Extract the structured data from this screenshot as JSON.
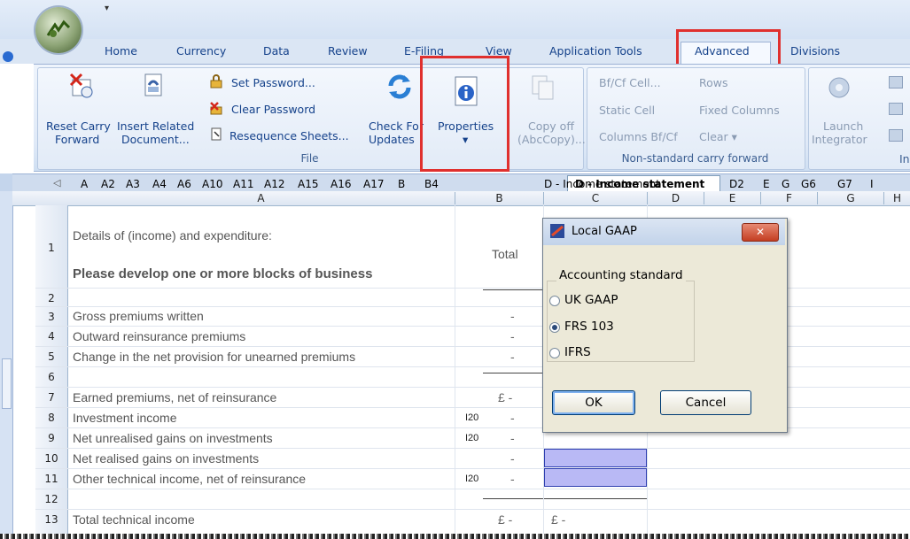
{
  "ribbon_tabs": {
    "home": "Home",
    "currency": "Currency",
    "data": "Data",
    "review": "Review",
    "efiling": "E-Filing",
    "view": "View",
    "application_tools": "Application Tools",
    "advanced": "Advanced",
    "divisions": "Divisions"
  },
  "file_group": {
    "reset_carry_1": "Reset Carry",
    "reset_carry_2": "Forward",
    "insert_related_1": "Insert Related",
    "insert_related_2": "Document...",
    "set_password": "Set Password...",
    "clear_password": "Clear Password",
    "resequence_sheets": "Resequence Sheets...",
    "check_updates_1": "Check For",
    "check_updates_2": "Updates",
    "properties": "Properties",
    "properties_arrow": "▾",
    "copy_off_1": "Copy off",
    "copy_off_2": "(AbcCopy)...",
    "label": "File"
  },
  "carry_group": {
    "bf_cf_cell": "Bf/Cf Cell...",
    "rows": "Rows",
    "static_cell": "Static Cell",
    "fixed_columns": "Fixed Columns",
    "columns_bf_cf": "Columns Bf/Cf",
    "clear": "Clear ▾",
    "label": "Non-standard carry forward"
  },
  "integrator_group": {
    "launch_1": "Launch",
    "launch_2": "Integrator",
    "label_partial": "In"
  },
  "sheet_tabs": [
    "A",
    "A2",
    "A3",
    "A4",
    "A6",
    "A10",
    "A11",
    "A12",
    "A15",
    "A16",
    "A17",
    "B",
    "B4",
    "D - Income statement",
    "D2",
    "E",
    "G",
    "G6",
    "G7",
    "I"
  ],
  "active_sheet": "D - Income statement",
  "columns": [
    "A",
    "B",
    "C",
    "D",
    "E",
    "F",
    "G",
    "H"
  ],
  "rows": [
    {
      "n": "1",
      "a": "Details of (income) and expenditure:",
      "b": "Total"
    },
    {
      "n": "2",
      "a": "Please develop one or more blocks of business"
    },
    {
      "n": "3",
      "a": "Gross premiums written",
      "b": "-"
    },
    {
      "n": "4",
      "a": "Outward reinsurance premiums",
      "b": "-"
    },
    {
      "n": "5",
      "a": "Change in the net provision for unearned premiums",
      "b": "-"
    },
    {
      "n": "6",
      "a": ""
    },
    {
      "n": "7",
      "a": "Earned premiums, net of reinsurance",
      "b": "£  -"
    },
    {
      "n": "8",
      "a": "Investment income",
      "tag": "I20",
      "b": "-"
    },
    {
      "n": "9",
      "a": "Net unrealised gains on investments",
      "tag": "I20",
      "b": "-"
    },
    {
      "n": "10",
      "a": "Net realised gains on investments",
      "b": "-"
    },
    {
      "n": "11",
      "a": "Other technical income, net of reinsurance",
      "tag": "I20",
      "b": "-"
    },
    {
      "n": "12",
      "a": ""
    },
    {
      "n": "13",
      "a": "Total technical income",
      "b": "£  -",
      "c": "£     -"
    }
  ],
  "dialog": {
    "title": "Local GAAP",
    "close": "✕",
    "group_label": "Accounting standard",
    "options": [
      "UK GAAP",
      "FRS 103",
      "IFRS"
    ],
    "selected": "FRS 103",
    "ok": "OK",
    "cancel": "Cancel"
  },
  "colors": {
    "highlight": "#e0302e",
    "ribbon_text": "#15428b",
    "input_cell": "#b9b9f5"
  }
}
